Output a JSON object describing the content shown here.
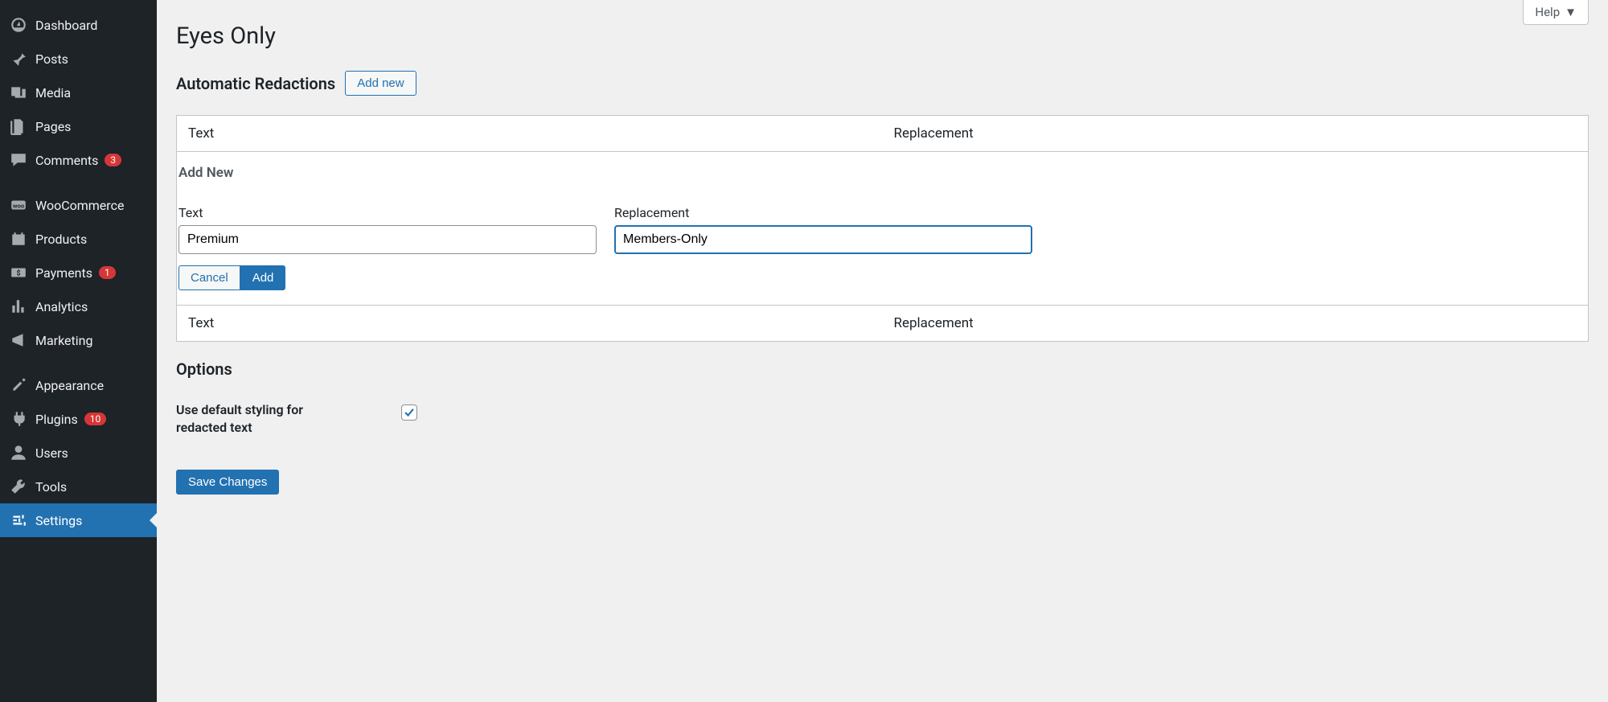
{
  "sidebar": {
    "items": [
      {
        "label": "Dashboard",
        "icon": "dashboard",
        "active": false
      },
      {
        "label": "Posts",
        "icon": "pin",
        "active": false
      },
      {
        "label": "Media",
        "icon": "media",
        "active": false
      },
      {
        "label": "Pages",
        "icon": "pages",
        "active": false
      },
      {
        "label": "Comments",
        "icon": "comment",
        "active": false,
        "badge": "3"
      },
      {
        "sep": true
      },
      {
        "label": "WooCommerce",
        "icon": "woo",
        "active": false
      },
      {
        "label": "Products",
        "icon": "products",
        "active": false
      },
      {
        "label": "Payments",
        "icon": "payments",
        "active": false,
        "badge": "1"
      },
      {
        "label": "Analytics",
        "icon": "analytics",
        "active": false
      },
      {
        "label": "Marketing",
        "icon": "marketing",
        "active": false
      },
      {
        "sep": true
      },
      {
        "label": "Appearance",
        "icon": "appearance",
        "active": false
      },
      {
        "label": "Plugins",
        "icon": "plugins",
        "active": false,
        "badge": "10"
      },
      {
        "label": "Users",
        "icon": "users",
        "active": false
      },
      {
        "label": "Tools",
        "icon": "tools",
        "active": false
      },
      {
        "label": "Settings",
        "icon": "settings",
        "active": true
      }
    ]
  },
  "header": {
    "help_label": "Help"
  },
  "page": {
    "title": "Eyes Only",
    "auto_redactions_title": "Automatic Redactions",
    "add_new_button": "Add new",
    "table": {
      "col_text": "Text",
      "col_replacement": "Replacement"
    },
    "form": {
      "add_new_title": "Add New",
      "text_label": "Text",
      "replacement_label": "Replacement",
      "text_value": "Premium",
      "replacement_value": "Members-Only",
      "cancel_label": "Cancel",
      "add_label": "Add"
    },
    "options": {
      "title": "Options",
      "use_default_styling_label": "Use default styling for redacted text",
      "use_default_styling_checked": true
    },
    "save_label": "Save Changes"
  }
}
